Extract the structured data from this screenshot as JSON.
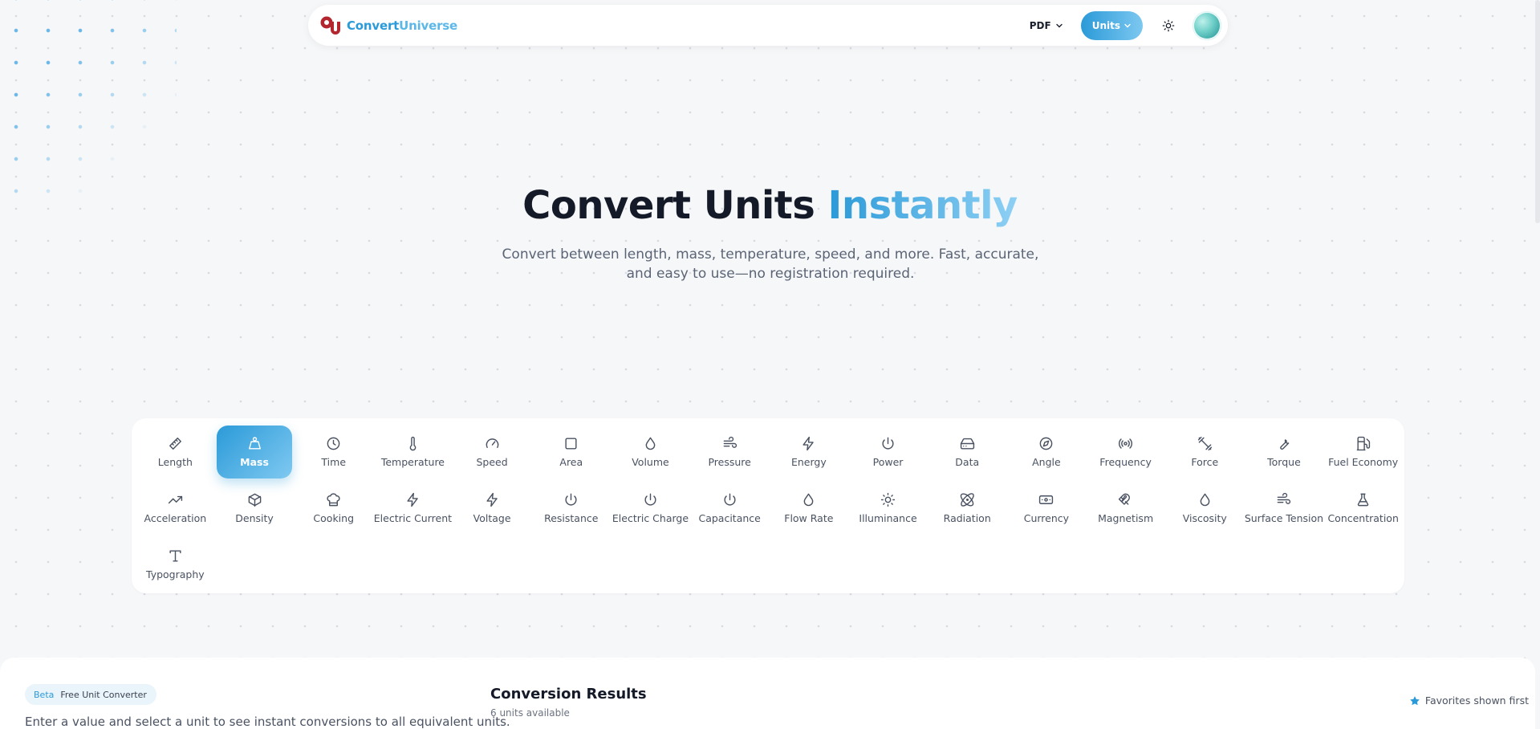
{
  "header": {
    "brand_part1": "Convert",
    "brand_part2": "Universe",
    "pdf_label": "PDF",
    "units_label": "Units"
  },
  "hero": {
    "title_main": "Convert Units ",
    "title_accent": "Instantly",
    "subtitle": "Convert between length, mass, temperature, speed, and more. Fast, accurate, and easy to use—no registration required."
  },
  "categories": [
    {
      "label": "Length",
      "icon": "ruler-icon",
      "active": false
    },
    {
      "label": "Mass",
      "icon": "weight-icon",
      "active": true
    },
    {
      "label": "Time",
      "icon": "clock-icon",
      "active": false
    },
    {
      "label": "Temperature",
      "icon": "thermometer-icon",
      "active": false
    },
    {
      "label": "Speed",
      "icon": "gauge-icon",
      "active": false
    },
    {
      "label": "Area",
      "icon": "square-icon",
      "active": false
    },
    {
      "label": "Volume",
      "icon": "droplet-icon",
      "active": false
    },
    {
      "label": "Pressure",
      "icon": "wind-icon",
      "active": false
    },
    {
      "label": "Energy",
      "icon": "zap-icon",
      "active": false
    },
    {
      "label": "Power",
      "icon": "power-icon",
      "active": false
    },
    {
      "label": "Data",
      "icon": "hard-drive-icon",
      "active": false
    },
    {
      "label": "Angle",
      "icon": "compass-icon",
      "active": false
    },
    {
      "label": "Frequency",
      "icon": "radio-icon",
      "active": false
    },
    {
      "label": "Force",
      "icon": "dumbbell-icon",
      "active": false
    },
    {
      "label": "Torque",
      "icon": "wrench-icon",
      "active": false
    },
    {
      "label": "Fuel Economy",
      "icon": "fuel-icon",
      "active": false
    },
    {
      "label": "Acceleration",
      "icon": "trending-up-icon",
      "active": false
    },
    {
      "label": "Density",
      "icon": "box-icon",
      "active": false
    },
    {
      "label": "Cooking",
      "icon": "chef-hat-icon",
      "active": false
    },
    {
      "label": "Electric Current",
      "icon": "zap-icon",
      "active": false
    },
    {
      "label": "Voltage",
      "icon": "zap-icon",
      "active": false
    },
    {
      "label": "Resistance",
      "icon": "power-icon",
      "active": false
    },
    {
      "label": "Electric Charge",
      "icon": "power-icon",
      "active": false
    },
    {
      "label": "Capacitance",
      "icon": "power-icon",
      "active": false
    },
    {
      "label": "Flow Rate",
      "icon": "droplet-icon",
      "active": false
    },
    {
      "label": "Illuminance",
      "icon": "sun-icon",
      "active": false
    },
    {
      "label": "Radiation",
      "icon": "atom-icon",
      "active": false
    },
    {
      "label": "Currency",
      "icon": "banknote-icon",
      "active": false
    },
    {
      "label": "Magnetism",
      "icon": "magnet-icon",
      "active": false
    },
    {
      "label": "Viscosity",
      "icon": "droplet-icon",
      "active": false
    },
    {
      "label": "Surface Tension",
      "icon": "wind-icon",
      "active": false
    },
    {
      "label": "Concentration",
      "icon": "flask-icon",
      "active": false
    },
    {
      "label": "Typography",
      "icon": "type-icon",
      "active": false
    }
  ],
  "bottom": {
    "badge_beta": "Beta",
    "badge_label": "Free Unit Converter",
    "intro": "Enter a value and select a unit to see instant conversions to all equivalent units.",
    "results_title": "Conversion Results",
    "results_count": "6 units available",
    "favorites_note": "Favorites shown first"
  },
  "colors": {
    "accent": "#2b9ad8",
    "accent_light": "#7fc9f1",
    "logo_red": "#b3262e"
  }
}
